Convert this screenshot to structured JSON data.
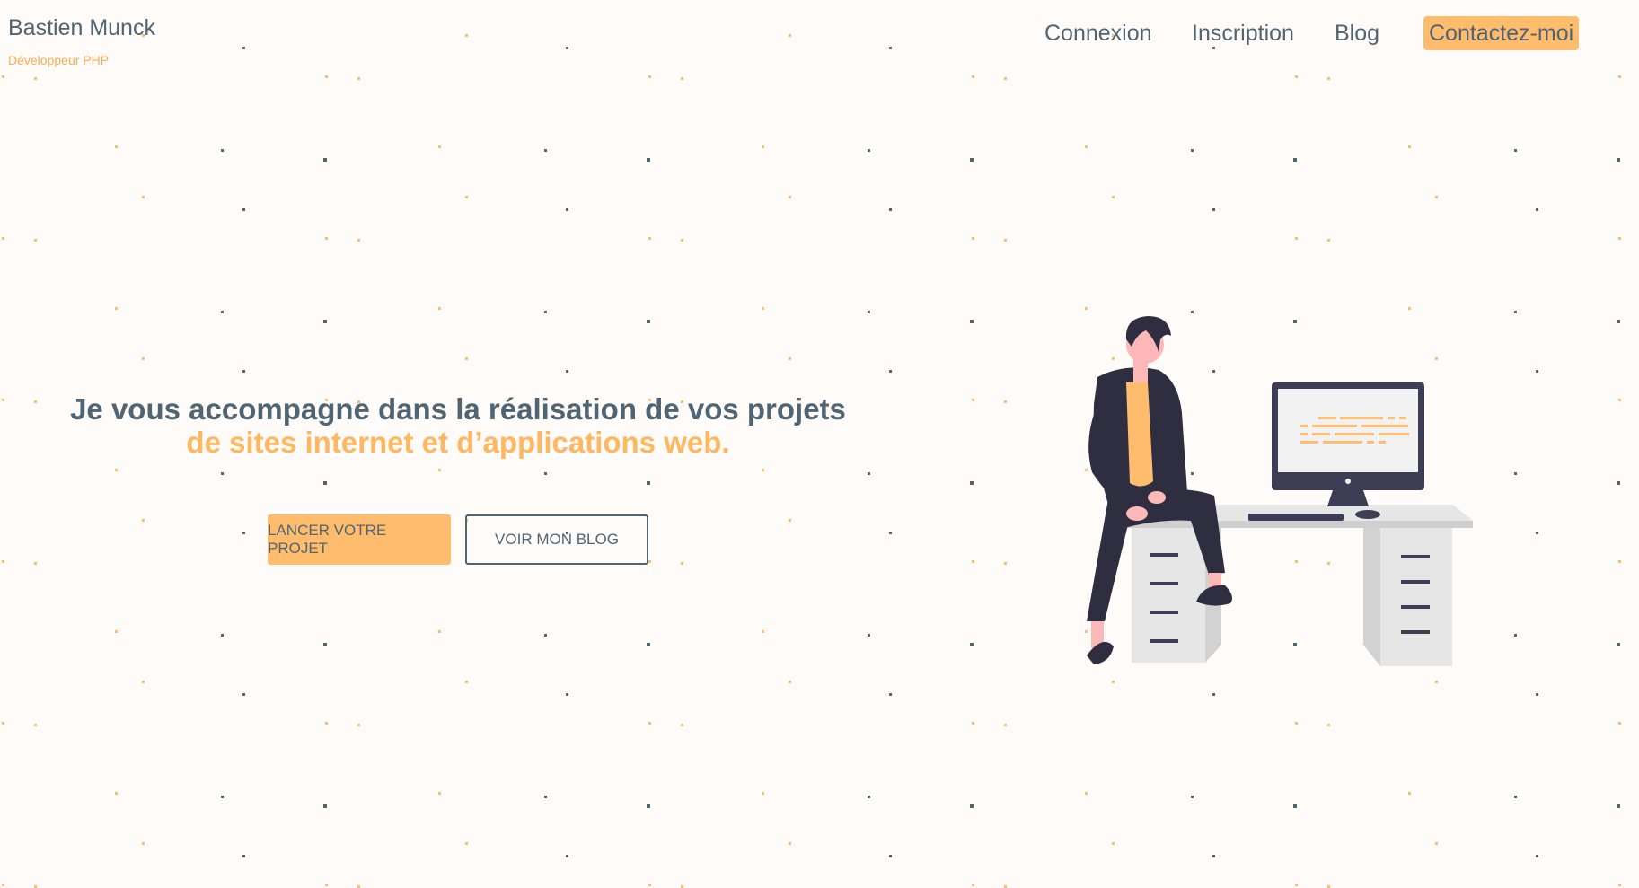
{
  "brand": {
    "name": "Bastien Munck",
    "subtitle": "Développeur PHP"
  },
  "nav": {
    "items": [
      {
        "label": "Connexion"
      },
      {
        "label": "Inscription"
      },
      {
        "label": "Blog"
      }
    ],
    "cta_label": "Contactez-moi"
  },
  "hero": {
    "headline_main": "Je vous accompagne dans la réalisation de vos projets ",
    "headline_highlight": "de sites internet et d’applications web.",
    "primary_button": "LANCER VOTRE PROJET",
    "secondary_button": "VOIR MON BLOG"
  },
  "colors": {
    "background": "#fffbf8",
    "text": "#506574",
    "accent": "#ffbc6d",
    "dark": "#2f2e41",
    "skin": "#ffb8b8",
    "desk": "#e6e6e6"
  },
  "illustration": {
    "name": "developer-at-desk"
  }
}
